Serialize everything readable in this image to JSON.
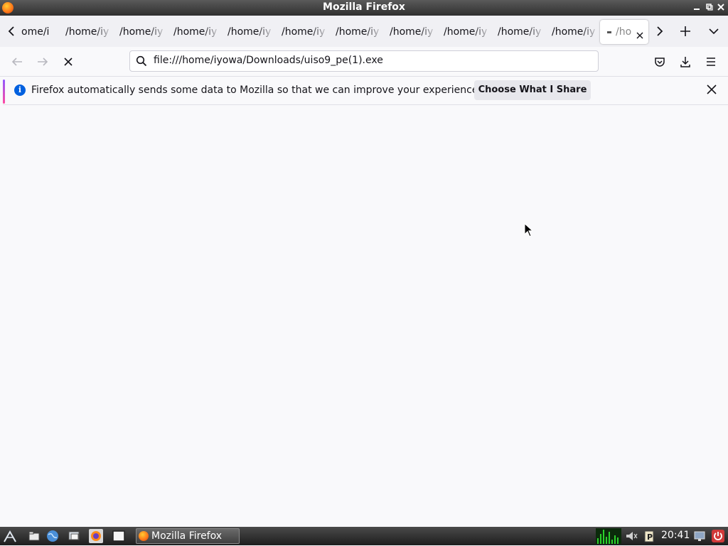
{
  "window": {
    "title": "Mozilla Firefox"
  },
  "tabs": {
    "items": [
      {
        "label": "ome/i"
      },
      {
        "label": "/home/iy"
      },
      {
        "label": "/home/iy"
      },
      {
        "label": "/home/iy"
      },
      {
        "label": "/home/iy"
      },
      {
        "label": "/home/iy"
      },
      {
        "label": "/home/iy"
      },
      {
        "label": "/home/iy"
      },
      {
        "label": "/home/iy"
      },
      {
        "label": "/home/iy"
      },
      {
        "label": "/home/iy"
      }
    ],
    "active": {
      "label": "/ho"
    }
  },
  "navbar": {
    "url": "file:///home/iyowa/Downloads/uiso9_pe(1).exe"
  },
  "notification": {
    "message": "Firefox automatically sends some data to Mozilla so that we can improve your experience.",
    "button_label": "Choose What I Share",
    "info_glyph": "i"
  },
  "taskbar": {
    "task_label": "Mozilla Firefox",
    "clock": "20:41"
  },
  "colors": {
    "accent": "#0060df",
    "notification_gradient_start": "#9059ff",
    "notification_gradient_end": "#ff4aa2"
  }
}
